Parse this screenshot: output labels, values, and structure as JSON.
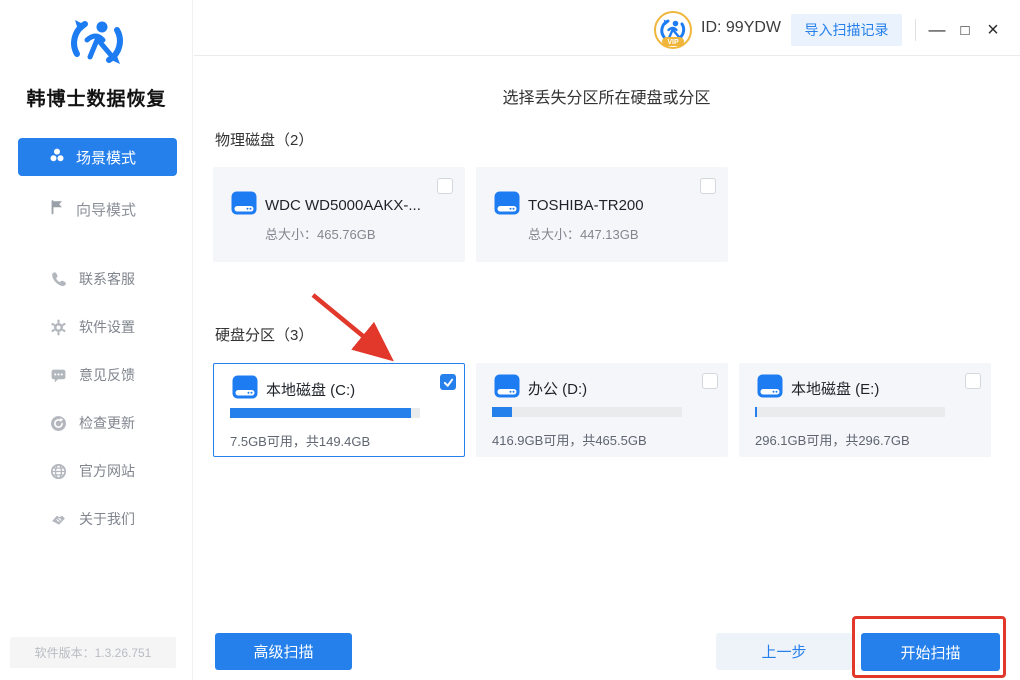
{
  "colors": {
    "accent": "#2680EB",
    "accent_light_bg": "#E9F2FD",
    "card_bg": "#F4F6FA",
    "annotation_red": "#E2382C"
  },
  "app": {
    "name": "韩博士数据恢复",
    "version": "软件版本：1.3.26.751"
  },
  "sidebar": {
    "modes": [
      {
        "label": "场景模式",
        "icon": "scene-mode-icon",
        "active": true
      },
      {
        "label": "向导模式",
        "icon": "wizard-flag-icon",
        "active": false
      }
    ],
    "items": [
      {
        "label": "联系客服",
        "icon": "phone-icon"
      },
      {
        "label": "软件设置",
        "icon": "gear-icon"
      },
      {
        "label": "意见反馈",
        "icon": "feedback-icon"
      },
      {
        "label": "检查更新",
        "icon": "update-icon"
      },
      {
        "label": "官方网站",
        "icon": "globe-icon"
      },
      {
        "label": "关于我们",
        "icon": "about-icon"
      }
    ]
  },
  "header": {
    "vip_badge": "VIP",
    "user_id": "ID: 99YDW",
    "import_button": "导入扫描记录",
    "minimize_glyph": "—",
    "maximize_glyph": "□",
    "close_glyph": "×"
  },
  "main": {
    "title": "选择丢失分区所在硬盘或分区",
    "physical_section": {
      "label": "物理磁盘（2）",
      "disks": [
        {
          "name": "WDC WD5000AAKX-...",
          "size": "总大小：465.76GB",
          "checked": false
        },
        {
          "name": "TOSHIBA-TR200",
          "size": "总大小：447.13GB",
          "checked": false
        }
      ]
    },
    "partition_section": {
      "label": "硬盘分区（3）",
      "partitions": [
        {
          "name": "本地磁盘 (C:)",
          "info": "7.5GB可用，共149.4GB",
          "used_percent": 95,
          "checked": true,
          "selected": true
        },
        {
          "name": "办公 (D:)",
          "info": "416.9GB可用，共465.5GB",
          "used_percent": 10.5,
          "checked": false,
          "selected": false
        },
        {
          "name": "本地磁盘 (E:)",
          "info": "296.1GB可用，共296.7GB",
          "used_percent": 0.8,
          "checked": false,
          "selected": false
        }
      ]
    }
  },
  "footer": {
    "advanced_scan": "高级扫描",
    "previous": "上一步",
    "start_scan": "开始扫描"
  }
}
